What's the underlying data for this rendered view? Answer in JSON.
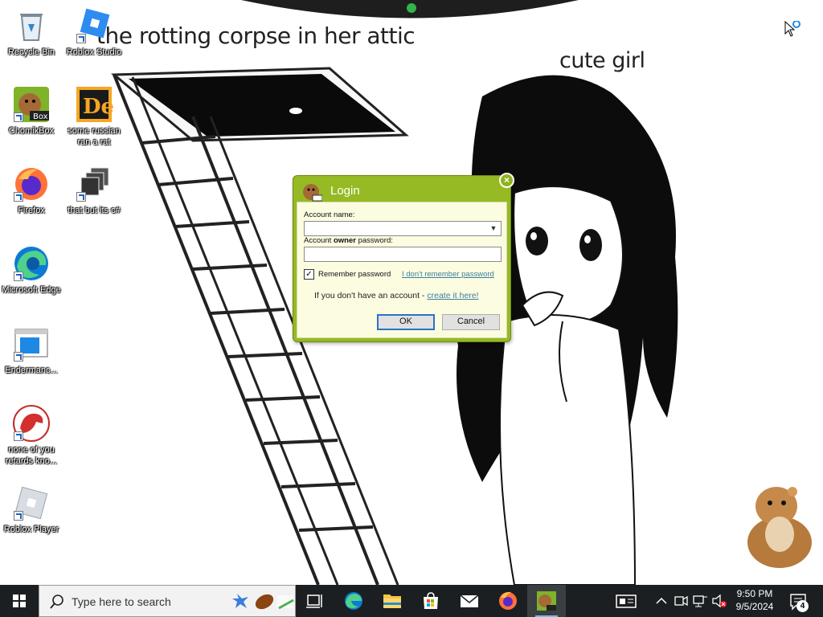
{
  "wallpaper": {
    "title": "the rotting corpse in her attic",
    "caption": "cute girl"
  },
  "desktop_icons": [
    {
      "label": "Recycle Bin",
      "icon": "recycle-bin-icon"
    },
    {
      "label": "Roblox Studio",
      "icon": "roblox-studio-icon"
    },
    {
      "label": "ChomikBox",
      "icon": "chomikbox-icon"
    },
    {
      "label": "some russian ran a rat",
      "icon": "russian-app-icon"
    },
    {
      "label": "Firefox",
      "icon": "firefox-icon"
    },
    {
      "label": "that but its c#",
      "icon": "windows-stack-icon"
    },
    {
      "label": "Microsoft Edge",
      "icon": "edge-icon"
    },
    {
      "label": "Endermanc...",
      "icon": "window-app-icon"
    },
    {
      "label": "none of you retards kno...",
      "icon": "dragon-icon"
    },
    {
      "label": "Roblox Player",
      "icon": "roblox-player-icon"
    }
  ],
  "login_dialog": {
    "title": "Login",
    "close_symbol": "×",
    "account_label": "Account name:",
    "account_value": "",
    "password_label_prefix": "Account ",
    "password_label_bold": "owner",
    "password_label_suffix": " password:",
    "password_value": "",
    "remember_label": "Remember password",
    "remember_checked": true,
    "forgot_link": "I don't remember password",
    "signup_text": "If you don't have an account - ",
    "signup_link": "create it here!",
    "ok_label": "OK",
    "cancel_label": "Cancel"
  },
  "taskbar": {
    "search_placeholder": "Type here to search",
    "pinned": [
      "task-view",
      "edge",
      "file-explorer",
      "microsoft-store",
      "mail",
      "firefox",
      "chomikbox"
    ],
    "active_app": "chomikbox",
    "clock_time": "9:50 PM",
    "clock_date": "9/5/2024",
    "notification_count": "4"
  },
  "colors": {
    "dialog_accent": "#95ba23",
    "dialog_body": "#fcfce1",
    "taskbar": "#1b1f22",
    "link": "#3a7f9e"
  }
}
